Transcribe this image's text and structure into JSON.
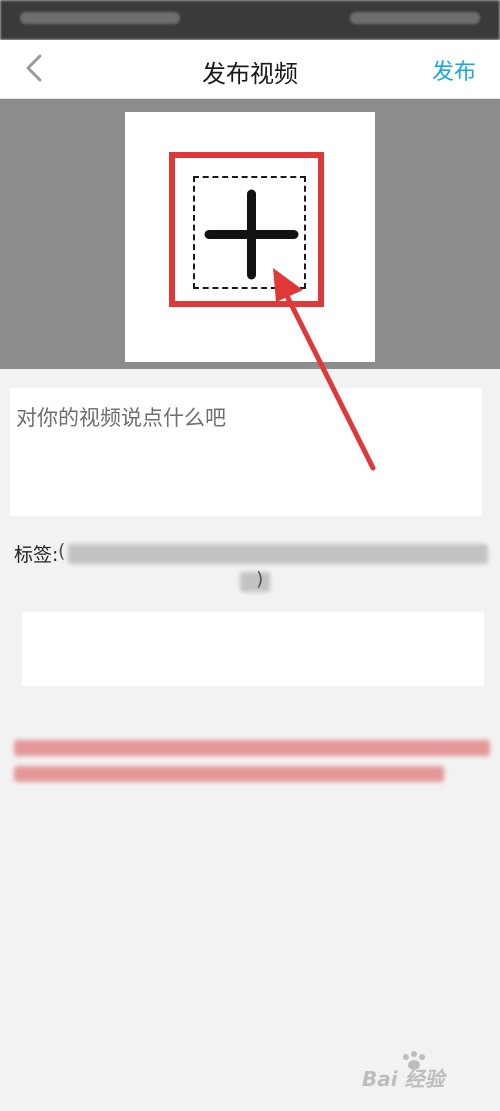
{
  "header": {
    "title": "发布视频",
    "publish_label": "发布"
  },
  "description": {
    "placeholder": "对你的视频说点什么吧"
  },
  "tags": {
    "label": "标签:",
    "hint_open": "(",
    "hint_close": ")"
  },
  "colors": {
    "accent": "#1aa5df",
    "highlight": "#e03838"
  },
  "icons": {
    "back": "chevron-left-icon",
    "add": "plus-icon",
    "watermark": "baidu-jingyan-logo"
  },
  "watermark": {
    "text": "Bai 经验"
  }
}
